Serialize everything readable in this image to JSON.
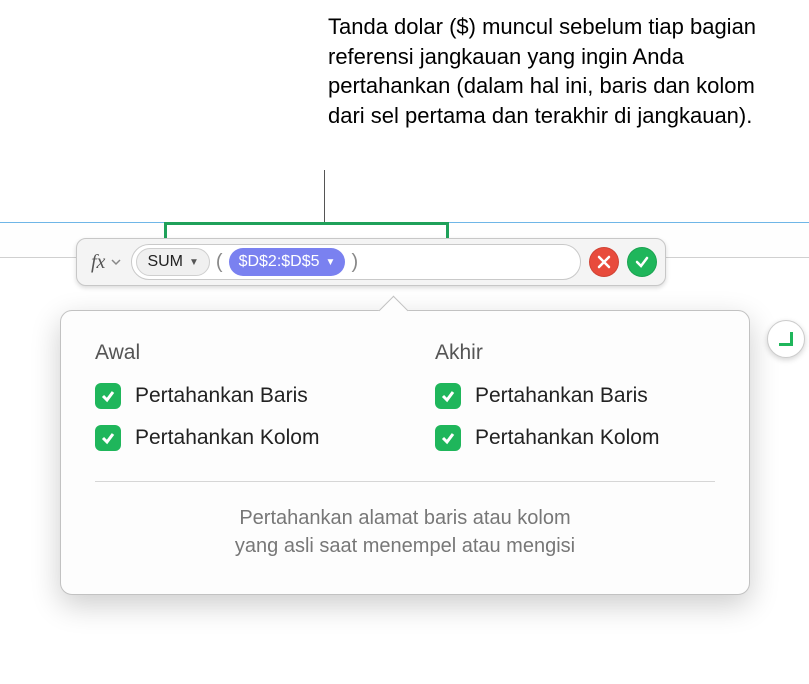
{
  "annotation": {
    "text": "Tanda dolar ($) muncul sebelum tiap bagian referensi jangkauan yang ingin Anda pertahankan (dalam hal ini, baris dan kolom dari sel pertama dan terakhir di jangkauan)."
  },
  "formula_bar": {
    "fx_label": "fx",
    "function_name": "SUM",
    "open_paren": "(",
    "range_ref": "$D$2:$D$5",
    "close_paren": ")"
  },
  "popover": {
    "start": {
      "heading": "Awal",
      "preserve_row": "Pertahankan Baris",
      "preserve_col": "Pertahankan Kolom"
    },
    "end": {
      "heading": "Akhir",
      "preserve_row": "Pertahankan Baris",
      "preserve_col": "Pertahankan Kolom"
    },
    "footer_line1": "Pertahankan alamat baris atau kolom",
    "footer_line2": "yang asli saat menempel atau mengisi"
  }
}
